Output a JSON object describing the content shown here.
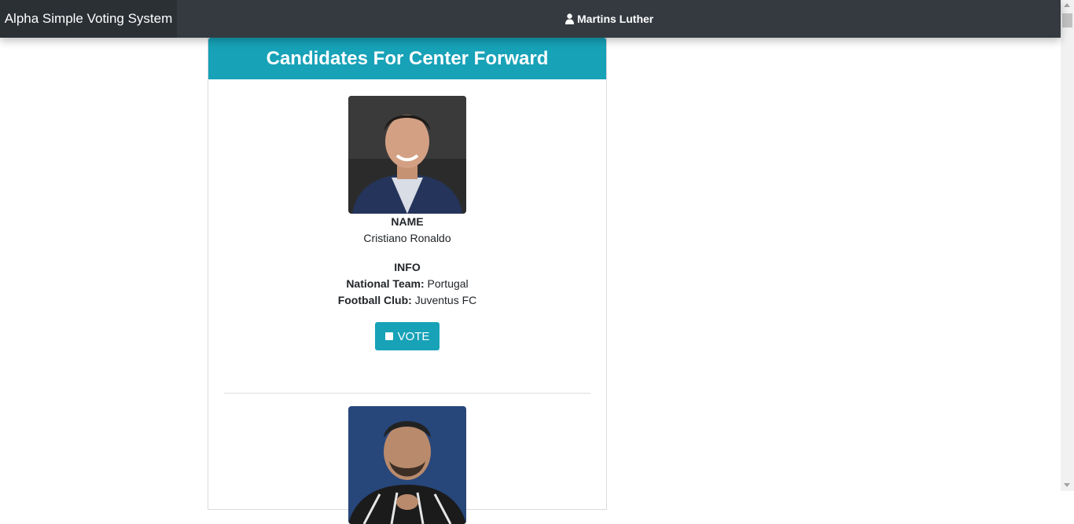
{
  "navbar": {
    "brand": "Alpha Simple Voting System",
    "user_name": "Martins Luther",
    "user_icon": "user-icon"
  },
  "card": {
    "title": "Candidates For Center Forward"
  },
  "candidates": [
    {
      "name_label": "NAME",
      "name": "Cristiano Ronaldo",
      "info_label": "INFO",
      "national_team_label": "National Team:",
      "national_team": "Portugal",
      "club_label": "Football Club:",
      "club": "Juventus FC",
      "vote_label": "VOTE",
      "vote_icon": "checkbox-icon"
    },
    {
      "photo_only": true
    }
  ],
  "colors": {
    "navbar": "#343a40",
    "brand_bg": "#2b3035",
    "accent": "#17a2b8"
  }
}
